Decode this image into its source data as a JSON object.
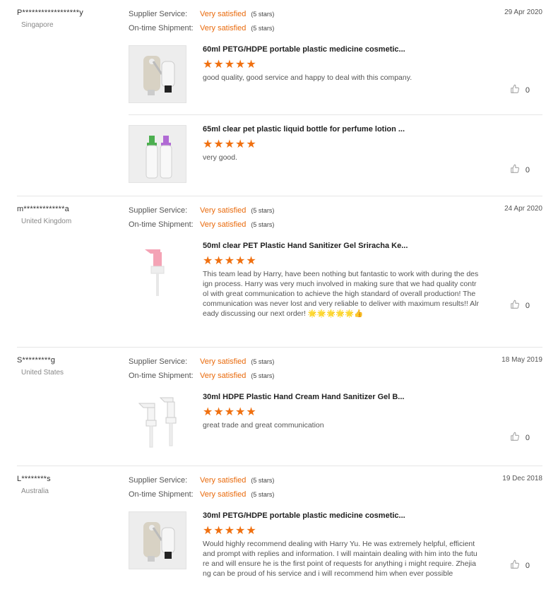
{
  "labels": {
    "supplier_service": "Supplier Service:",
    "ontime_shipment": "On-time Shipment:"
  },
  "reviews": [
    {
      "buyer": "P******************y",
      "country": "Singapore",
      "date": "29 Apr 2020",
      "supplier_service": "Very satisfied",
      "supplier_stars": "(5 stars)",
      "shipment": "Very satisfied",
      "shipment_stars": "(5 stars)",
      "products": [
        {
          "title": "60ml PETG/HDPE portable plastic medicine cosmetic...",
          "stars": "★★★★★",
          "comment": "good quality, good service and happy to deal with this company.",
          "likes": "0",
          "image": "hook-bottles"
        },
        {
          "title": "65ml clear pet plastic liquid bottle for perfume lotion ...",
          "stars": "★★★★★",
          "comment": "very good.",
          "likes": "0",
          "image": "spray-bottles"
        }
      ]
    },
    {
      "buyer": "m*************a",
      "country": "United Kingdom",
      "date": "24 Apr 2020",
      "supplier_service": "Very satisfied",
      "supplier_stars": "(5 stars)",
      "shipment": "Very satisfied",
      "shipment_stars": "(5 stars)",
      "products": [
        {
          "title": "50ml clear PET Plastic Hand Sanitizer Gel Sriracha Ke...",
          "stars": "★★★★★",
          "comment": "This team lead by Harry, have been nothing but fantastic to work with during the design process. Harry was very much involved in making sure that we had quality control with great communication to achieve the high standard of overall production! The communication was never lost and very reliable to deliver with maximum results!! Already discussing our next order! 🌟🌟🌟🌟🌟👍",
          "likes": "0",
          "image": "pink-pump"
        }
      ]
    },
    {
      "buyer": "S*********g",
      "country": "United States",
      "date": "18 May 2019",
      "supplier_service": "Very satisfied",
      "supplier_stars": "(5 stars)",
      "shipment": "Very satisfied",
      "shipment_stars": "(5 stars)",
      "products": [
        {
          "title": "30ml HDPE Plastic Hand Cream Hand Sanitizer Gel B...",
          "stars": "★★★★★",
          "comment": "great trade and great communication",
          "likes": "0",
          "image": "white-pumps"
        }
      ]
    },
    {
      "buyer": "L********s",
      "country": "Australia",
      "date": "19 Dec 2018",
      "supplier_service": "Very satisfied",
      "supplier_stars": "(5 stars)",
      "shipment": "Very satisfied",
      "shipment_stars": "(5 stars)",
      "products": [
        {
          "title": "30ml PETG/HDPE portable plastic medicine cosmetic...",
          "stars": "★★★★★",
          "comment": "Would highly recommend dealing with Harry Yu. He was extremely helpful, efficient and prompt with replies and information. I will maintain dealing with him into the future and will ensure he is the first point of requests for anything i might require. Zhejiang can be proud of his service and i will recommend him when ever possible",
          "likes": "0",
          "image": "hook-bottles"
        }
      ]
    }
  ],
  "colors": {
    "accent": "#e96a0c",
    "star": "#f07010",
    "divider": "#e6e6e6"
  },
  "icons": {
    "like": "thumbs-up-icon"
  }
}
